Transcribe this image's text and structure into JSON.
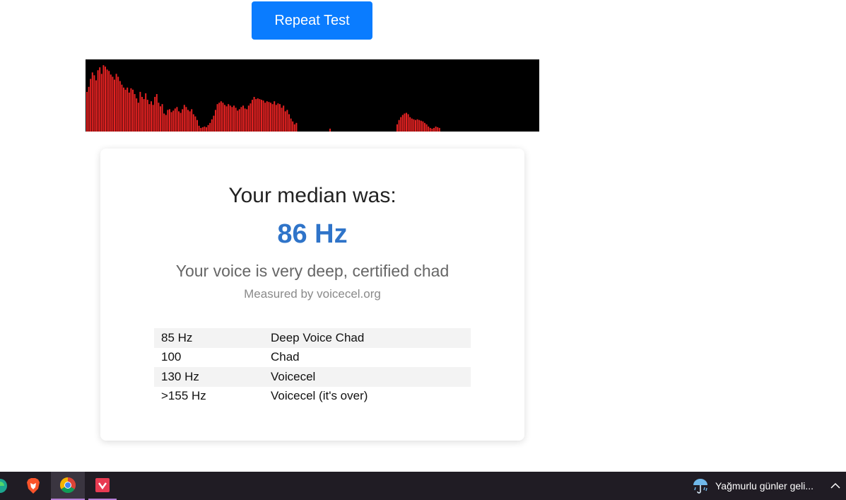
{
  "header": {
    "repeat_label": "Repeat Test"
  },
  "visualizer": {
    "colors": {
      "background": "#000000",
      "bar": "#e52222"
    },
    "levels": [
      0.55,
      0.62,
      0.73,
      0.82,
      0.78,
      0.71,
      0.85,
      0.89,
      0.8,
      0.92,
      0.9,
      0.86,
      0.84,
      0.79,
      0.76,
      0.72,
      0.8,
      0.76,
      0.7,
      0.65,
      0.61,
      0.58,
      0.61,
      0.54,
      0.6,
      0.58,
      0.52,
      0.46,
      0.4,
      0.55,
      0.48,
      0.45,
      0.53,
      0.44,
      0.38,
      0.42,
      0.37,
      0.48,
      0.52,
      0.4,
      0.35,
      0.38,
      0.25,
      0.23,
      0.3,
      0.31,
      0.27,
      0.29,
      0.32,
      0.34,
      0.28,
      0.26,
      0.31,
      0.37,
      0.34,
      0.3,
      0.28,
      0.31,
      0.24,
      0.21,
      0.16,
      0.08,
      0.05,
      0.06,
      0.07,
      0.06,
      0.09,
      0.12,
      0.17,
      0.22,
      0.3,
      0.38,
      0.4,
      0.42,
      0.4,
      0.37,
      0.35,
      0.38,
      0.36,
      0.34,
      0.36,
      0.33,
      0.29,
      0.31,
      0.34,
      0.36,
      0.32,
      0.31,
      0.36,
      0.39,
      0.44,
      0.48,
      0.45,
      0.46,
      0.45,
      0.44,
      0.43,
      0.4,
      0.42,
      0.41,
      0.4,
      0.38,
      0.42,
      0.37,
      0.39,
      0.38,
      0.33,
      0.36,
      0.28,
      0.3,
      0.24,
      0.18,
      0.14,
      0.1,
      0.12
    ],
    "levels_right": [
      0.04
    ],
    "levels_far": [
      0.1,
      0.16,
      0.2,
      0.23,
      0.25,
      0.26,
      0.24,
      0.2,
      0.18,
      0.17,
      0.16,
      0.17,
      0.16,
      0.15,
      0.14,
      0.12,
      0.1,
      0.07,
      0.05,
      0.04,
      0.05,
      0.07,
      0.06,
      0.05
    ]
  },
  "result": {
    "label": "Your median was:",
    "value": "86 Hz",
    "verdict": "Your voice is very deep, certified chad",
    "measured_by": "Measured by voicecel.org",
    "ranges": [
      {
        "freq": "85 Hz",
        "desc": "Deep Voice Chad"
      },
      {
        "freq": "100",
        "desc": "Chad"
      },
      {
        "freq": "130 Hz",
        "desc": "Voicecel"
      },
      {
        "freq": ">155 Hz",
        "desc": "Voicecel (it's over)"
      }
    ]
  },
  "taskbar": {
    "apps": [
      {
        "icon": "edge-icon"
      },
      {
        "icon": "brave-icon"
      },
      {
        "icon": "chrome-icon"
      },
      {
        "icon": "app-icon"
      }
    ],
    "weather": {
      "icon": "umbrella-rain-icon",
      "text": "Yağmurlu günler geli..."
    },
    "tray_icon": "chevron-up-icon"
  }
}
